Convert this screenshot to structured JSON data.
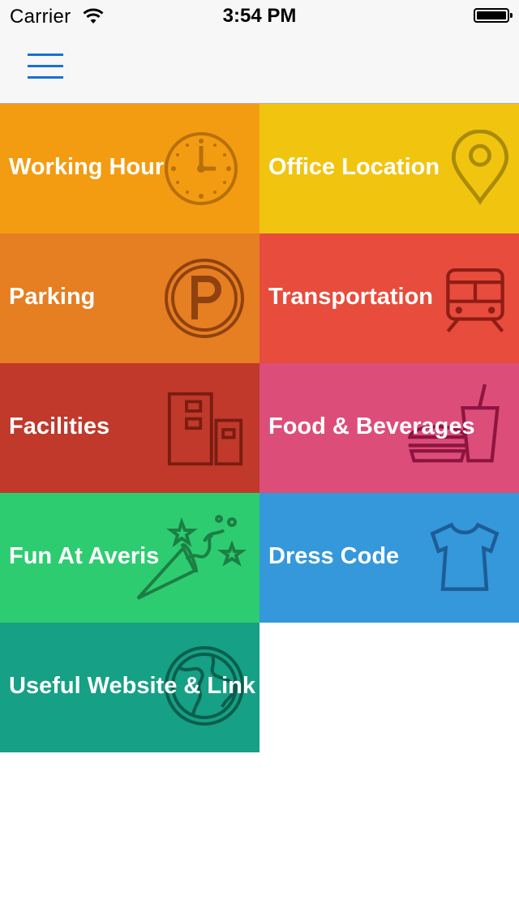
{
  "status_bar": {
    "carrier": "Carrier",
    "time": "3:54 PM"
  },
  "nav": {
    "menu_icon": "hamburger-menu-icon",
    "accent": "#1a6fd6"
  },
  "tiles": [
    {
      "label": "Working Hour",
      "icon": "clock-icon",
      "color": "#f39c12"
    },
    {
      "label": "Office Location",
      "icon": "map-pin-icon",
      "color": "#f1c40f"
    },
    {
      "label": "Parking",
      "icon": "parking-icon",
      "color": "#e67e22"
    },
    {
      "label": "Transportation",
      "icon": "train-icon",
      "color": "#e74c3c"
    },
    {
      "label": "Facilities",
      "icon": "buildings-icon",
      "color": "#c0392b"
    },
    {
      "label": "Food & Beverages",
      "icon": "food-drink-icon",
      "color": "#dc4d7a"
    },
    {
      "label": "Fun At Averis",
      "icon": "party-popper-icon",
      "color": "#2ecc71"
    },
    {
      "label": "Dress Code",
      "icon": "tshirt-icon",
      "color": "#3498db"
    },
    {
      "label": "Useful Website & Link",
      "icon": "globe-icon",
      "color": "#16a085"
    }
  ]
}
